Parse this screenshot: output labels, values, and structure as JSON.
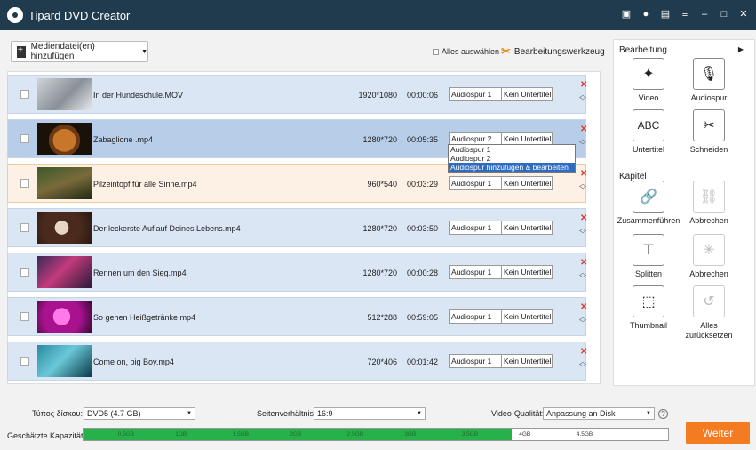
{
  "window": {
    "title": "Tipard DVD Creator"
  },
  "toolbar": {
    "add_media_label": "Mediendatei(en) hinzufügen",
    "select_all_label": "Alles auswählen",
    "edit_tool_label": "Bearbeitungswerkzeug"
  },
  "rows": [
    {
      "name": "In der Hundeschule.MOV",
      "resolution": "1920*1080",
      "duration": "00:00:06",
      "audio": "Audiospur 1",
      "subtitle": "Kein Untertitel"
    },
    {
      "name": "Zabaglione .mp4",
      "resolution": "1280*720",
      "duration": "00:05:35",
      "audio": "Audiospur 2",
      "subtitle": "Kein Untertitel"
    },
    {
      "name": "Pilzeintopf für alle Sinne.mp4",
      "resolution": "960*540",
      "duration": "00:03:29",
      "audio": "Audiospur 1",
      "subtitle": "Kein Untertitel"
    },
    {
      "name": "Der leckerste Auflauf Deines Lebens.mp4",
      "resolution": "1280*720",
      "duration": "00:03:50",
      "audio": "Audiospur 1",
      "subtitle": "Kein Untertitel"
    },
    {
      "name": "Rennen um den Sieg.mp4",
      "resolution": "1280*720",
      "duration": "00:00:28",
      "audio": "Audiospur 1",
      "subtitle": "Kein Untertitel"
    },
    {
      "name": "So gehen Heißgetränke.mp4",
      "resolution": "512*288",
      "duration": "00:59:05",
      "audio": "Audiospur 1",
      "subtitle": "Kein Untertitel"
    },
    {
      "name": "Come on, big Boy.mp4",
      "resolution": "720*406",
      "duration": "00:01:42",
      "audio": "Audiospur 1",
      "subtitle": "Kein Untertitel"
    }
  ],
  "dropdown": {
    "options": [
      "Audiospur 1",
      "Audiospur 2",
      "Audiospur hinzufügen & bearbeiten"
    ]
  },
  "panel": {
    "edit_heading": "Bearbeitung",
    "chapter_heading": "Kapitel",
    "tools": {
      "video": "Video",
      "audio": "Audiospur",
      "subtitle": "Untertitel",
      "subtitle_icon_text": "ABC",
      "cut": "Schneiden",
      "merge": "Zusammenführen",
      "merge_cancel": "Abbrechen",
      "split": "Splitten",
      "split_cancel": "Abbrechen",
      "thumbnail": "Thumbnail",
      "reset_line1": "Alles",
      "reset_line2": "zurücksetzen"
    }
  },
  "bottom": {
    "disc_type_label": "Τύπος δίσκου:",
    "disc_type_value": "DVD5 (4.7 GB)",
    "aspect_label": "Seitenverhältnis:",
    "aspect_value": "16:9",
    "quality_label": "Video-Qualität:",
    "quality_value": "Anpassung an Disk",
    "capacity_label": "Geschätzte Kapazität:",
    "capacity_ticks": [
      "0.5GB",
      "1GB",
      "1.5GB",
      "2GB",
      "2.5GB",
      "3GB",
      "3.5GB",
      "4GB",
      "4.5GB"
    ],
    "capacity_used_fraction": 0.733,
    "next_button": "Weiter"
  },
  "colors": {
    "titlebar": "#1f3b4d",
    "accent": "#f47b20",
    "capacity": "#27b14a",
    "delete": "#e03a2f",
    "selection": "#2d6cc0"
  }
}
